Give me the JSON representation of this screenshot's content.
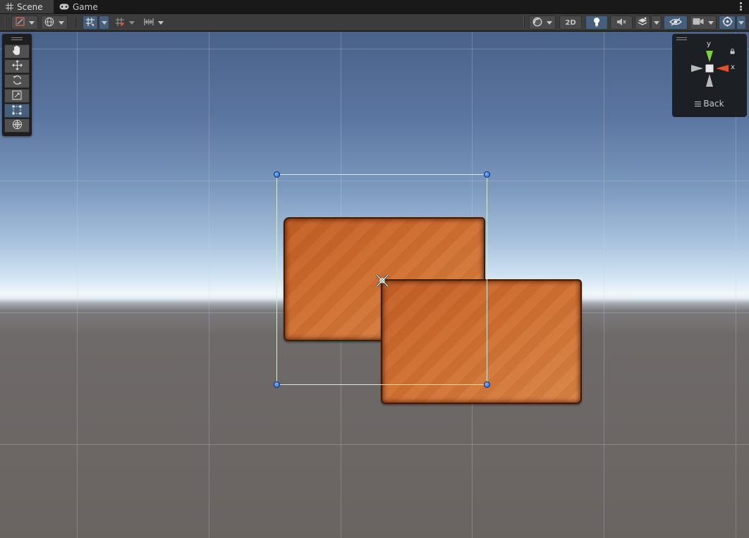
{
  "tabs": [
    {
      "label": "Scene",
      "icon": "scene-grid-icon",
      "active": true
    },
    {
      "label": "Game",
      "icon": "gamepad-icon",
      "active": false
    }
  ],
  "toolbar": {
    "view_2d_label": "2D",
    "items": [
      "draw-mode",
      "global-local",
      "grid-snapping",
      "increment-snap",
      "ruler",
      "shading-mode",
      "2D",
      "lighting",
      "audio",
      "effects",
      "visibility",
      "camera",
      "gizmos"
    ],
    "active_color": "#46607c"
  },
  "tools": [
    {
      "name": "hand-tool",
      "active": false
    },
    {
      "name": "move-tool",
      "active": false
    },
    {
      "name": "rotate-tool",
      "active": false
    },
    {
      "name": "scale-tool",
      "active": false
    },
    {
      "name": "rect-tool",
      "active": true
    },
    {
      "name": "transform-tool",
      "active": false
    }
  ],
  "gizmo": {
    "y_label": "y",
    "x_label": "x",
    "view_label": "Back",
    "y_color": "#7fd13b",
    "x_color": "#e0522a"
  },
  "scene": {
    "sprite_color": "#cf6e30",
    "selection_color": "#d6ecd6",
    "handle_color": "#2f7be6"
  }
}
